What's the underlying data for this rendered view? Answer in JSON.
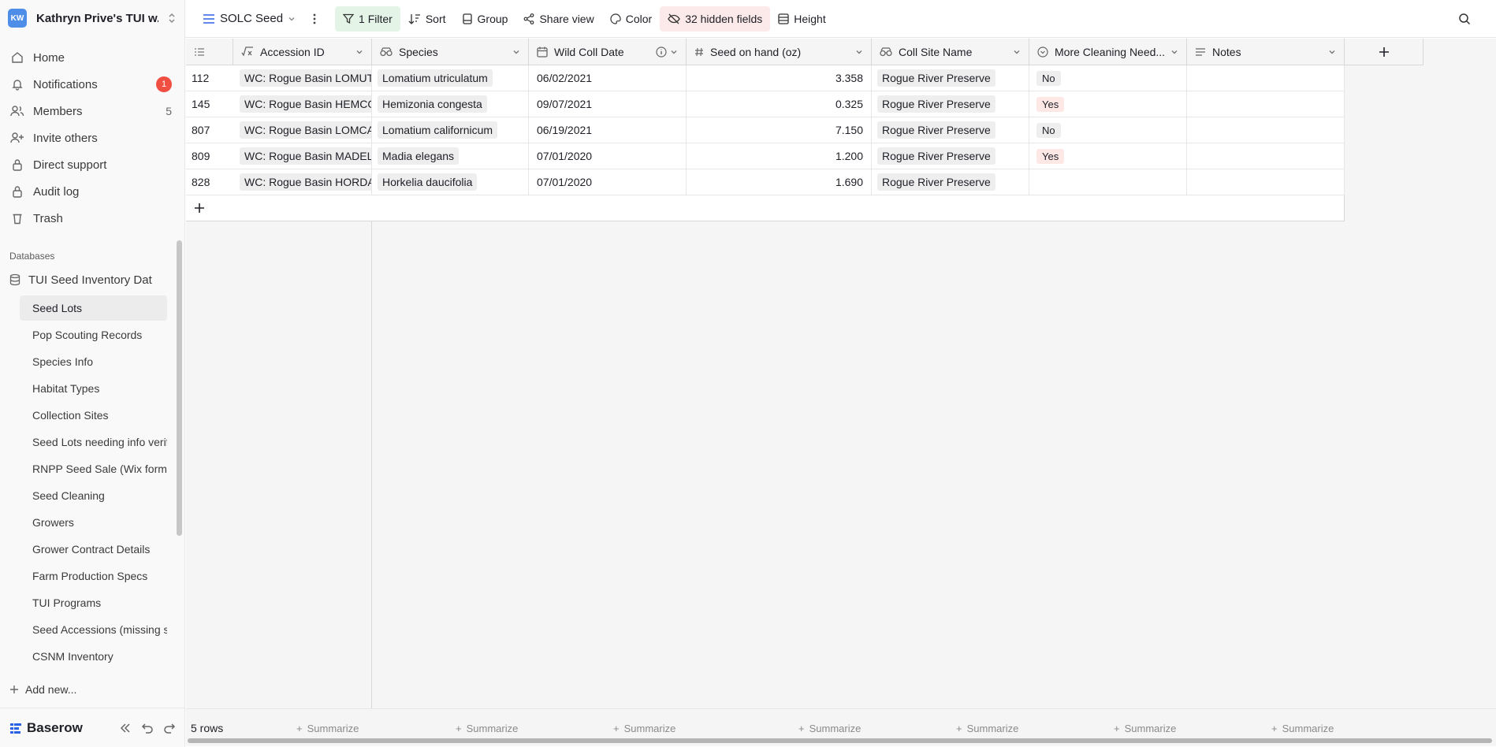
{
  "workspace": {
    "initials": "KW",
    "name": "Kathryn Prive's TUI w..."
  },
  "nav": {
    "home": "Home",
    "notifications": "Notifications",
    "notifications_count": "1",
    "members": "Members",
    "members_count": "5",
    "invite": "Invite others",
    "support": "Direct support",
    "audit": "Audit log",
    "trash": "Trash"
  },
  "databases_heading": "Databases",
  "database_name": "TUI Seed Inventory Dat",
  "tables": [
    "Seed Lots",
    "Pop Scouting Records",
    "Species Info",
    "Habitat Types",
    "Collection Sites",
    "Seed Lots needing info verif",
    "RNPP Seed Sale (Wix forma",
    "Seed Cleaning",
    "Growers",
    "Grower Contract Details",
    "Farm Production Specs",
    "TUI Programs",
    "Seed Accessions (missing s",
    "CSNM Inventory"
  ],
  "add_new": "Add new...",
  "brand": "Baserow",
  "toolbar": {
    "view": "SOLC Seed",
    "filter": "1 Filter",
    "sort": "Sort",
    "group": "Group",
    "share": "Share view",
    "color": "Color",
    "hidden": "32 hidden fields",
    "height": "Height"
  },
  "columns": {
    "accession": "Accession ID",
    "species": "Species",
    "date": "Wild Coll Date",
    "seed": "Seed on hand (oz)",
    "site": "Coll Site Name",
    "cleaning": "More Cleaning Need...",
    "notes": "Notes"
  },
  "rows": [
    {
      "id": "112",
      "accession": "WC: Rogue Basin LOMUT",
      "species": "Lomatium utriculatum",
      "date": "06/02/2021",
      "seed": "3.358",
      "site": "Rogue River Preserve",
      "cleaning": "No"
    },
    {
      "id": "145",
      "accession": "WC: Rogue Basin HEMCO",
      "species": "Hemizonia congesta",
      "date": "09/07/2021",
      "seed": "0.325",
      "site": "Rogue River Preserve",
      "cleaning": "Yes"
    },
    {
      "id": "807",
      "accession": "WC: Rogue Basin LOMCA",
      "species": "Lomatium californicum",
      "date": "06/19/2021",
      "seed": "7.150",
      "site": "Rogue River Preserve",
      "cleaning": "No"
    },
    {
      "id": "809",
      "accession": "WC: Rogue Basin MADELI",
      "species": "Madia elegans",
      "date": "07/01/2020",
      "seed": "1.200",
      "site": "Rogue River Preserve",
      "cleaning": "Yes"
    },
    {
      "id": "828",
      "accession": "WC: Rogue Basin HORDA",
      "species": "Horkelia daucifolia",
      "date": "07/01/2020",
      "seed": "1.690",
      "site": "Rogue River Preserve",
      "cleaning": ""
    }
  ],
  "footer": {
    "rows": "5 rows",
    "summarize": "Summarize"
  }
}
